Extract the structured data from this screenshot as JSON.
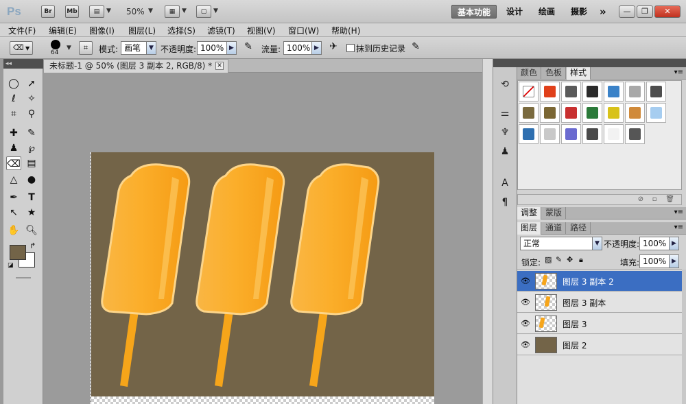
{
  "app": {
    "logo": "Ps",
    "bridge_label": "Br",
    "minibridge_label": "Mb",
    "zoom_value": "50%",
    "workspaces": [
      "基本功能",
      "设计",
      "绘画",
      "摄影"
    ],
    "more_label": "»"
  },
  "menu": [
    "文件(F)",
    "编辑(E)",
    "图像(I)",
    "图层(L)",
    "选择(S)",
    "滤镜(T)",
    "视图(V)",
    "窗口(W)",
    "帮助(H)"
  ],
  "options": {
    "brush_size": "64",
    "mode_label": "模式:",
    "mode_value": "画笔",
    "opacity_label": "不透明度:",
    "opacity_value": "100%",
    "flow_label": "流量:",
    "flow_value": "100%",
    "erase_history_label": "抹到历史记录"
  },
  "document": {
    "tab_title": "未标题-1 @ 50% (图层 3 副本 2, RGB/8) *",
    "canvas_color": "#736448",
    "popsicle_color": "#f6a51a",
    "popsicle_count": 3
  },
  "styles_panel": {
    "tabs": [
      "颜色",
      "色板",
      "样式"
    ],
    "active_tab": "样式",
    "swatch_colors": [
      "#ffffff",
      "#e0401a",
      "#5a5a5a",
      "#2a2a2a",
      "#3a82c8",
      "#a8a8a8",
      "#4e4e4e",
      "#7a6a3e",
      "#7b6734",
      "#c83030",
      "#2b7a3a",
      "#d8c21a",
      "#d08a3a",
      "#a6cdf0",
      "#2e6fb0",
      "#c9c9c9",
      "#6a6ad0",
      "#4a4a4a",
      "#f2f2f2",
      "#565656"
    ]
  },
  "adjust_panel": {
    "tabs": [
      "调整",
      "蒙版"
    ]
  },
  "layers_panel": {
    "tabs": [
      "图层",
      "通道",
      "路径"
    ],
    "blend_mode": "正常",
    "opacity_label": "不透明度:",
    "opacity_value": "100%",
    "lock_label": "锁定:",
    "fill_label": "填充:",
    "fill_value": "100%",
    "layers": [
      {
        "name": "图层 3 副本 2",
        "selected": true
      },
      {
        "name": "图层 3 副本",
        "selected": false
      },
      {
        "name": "图层 3",
        "selected": false
      },
      {
        "name": "图层 2",
        "selected": false
      }
    ]
  },
  "tools": {
    "foreground": "#736448",
    "background": "#ffffff"
  }
}
